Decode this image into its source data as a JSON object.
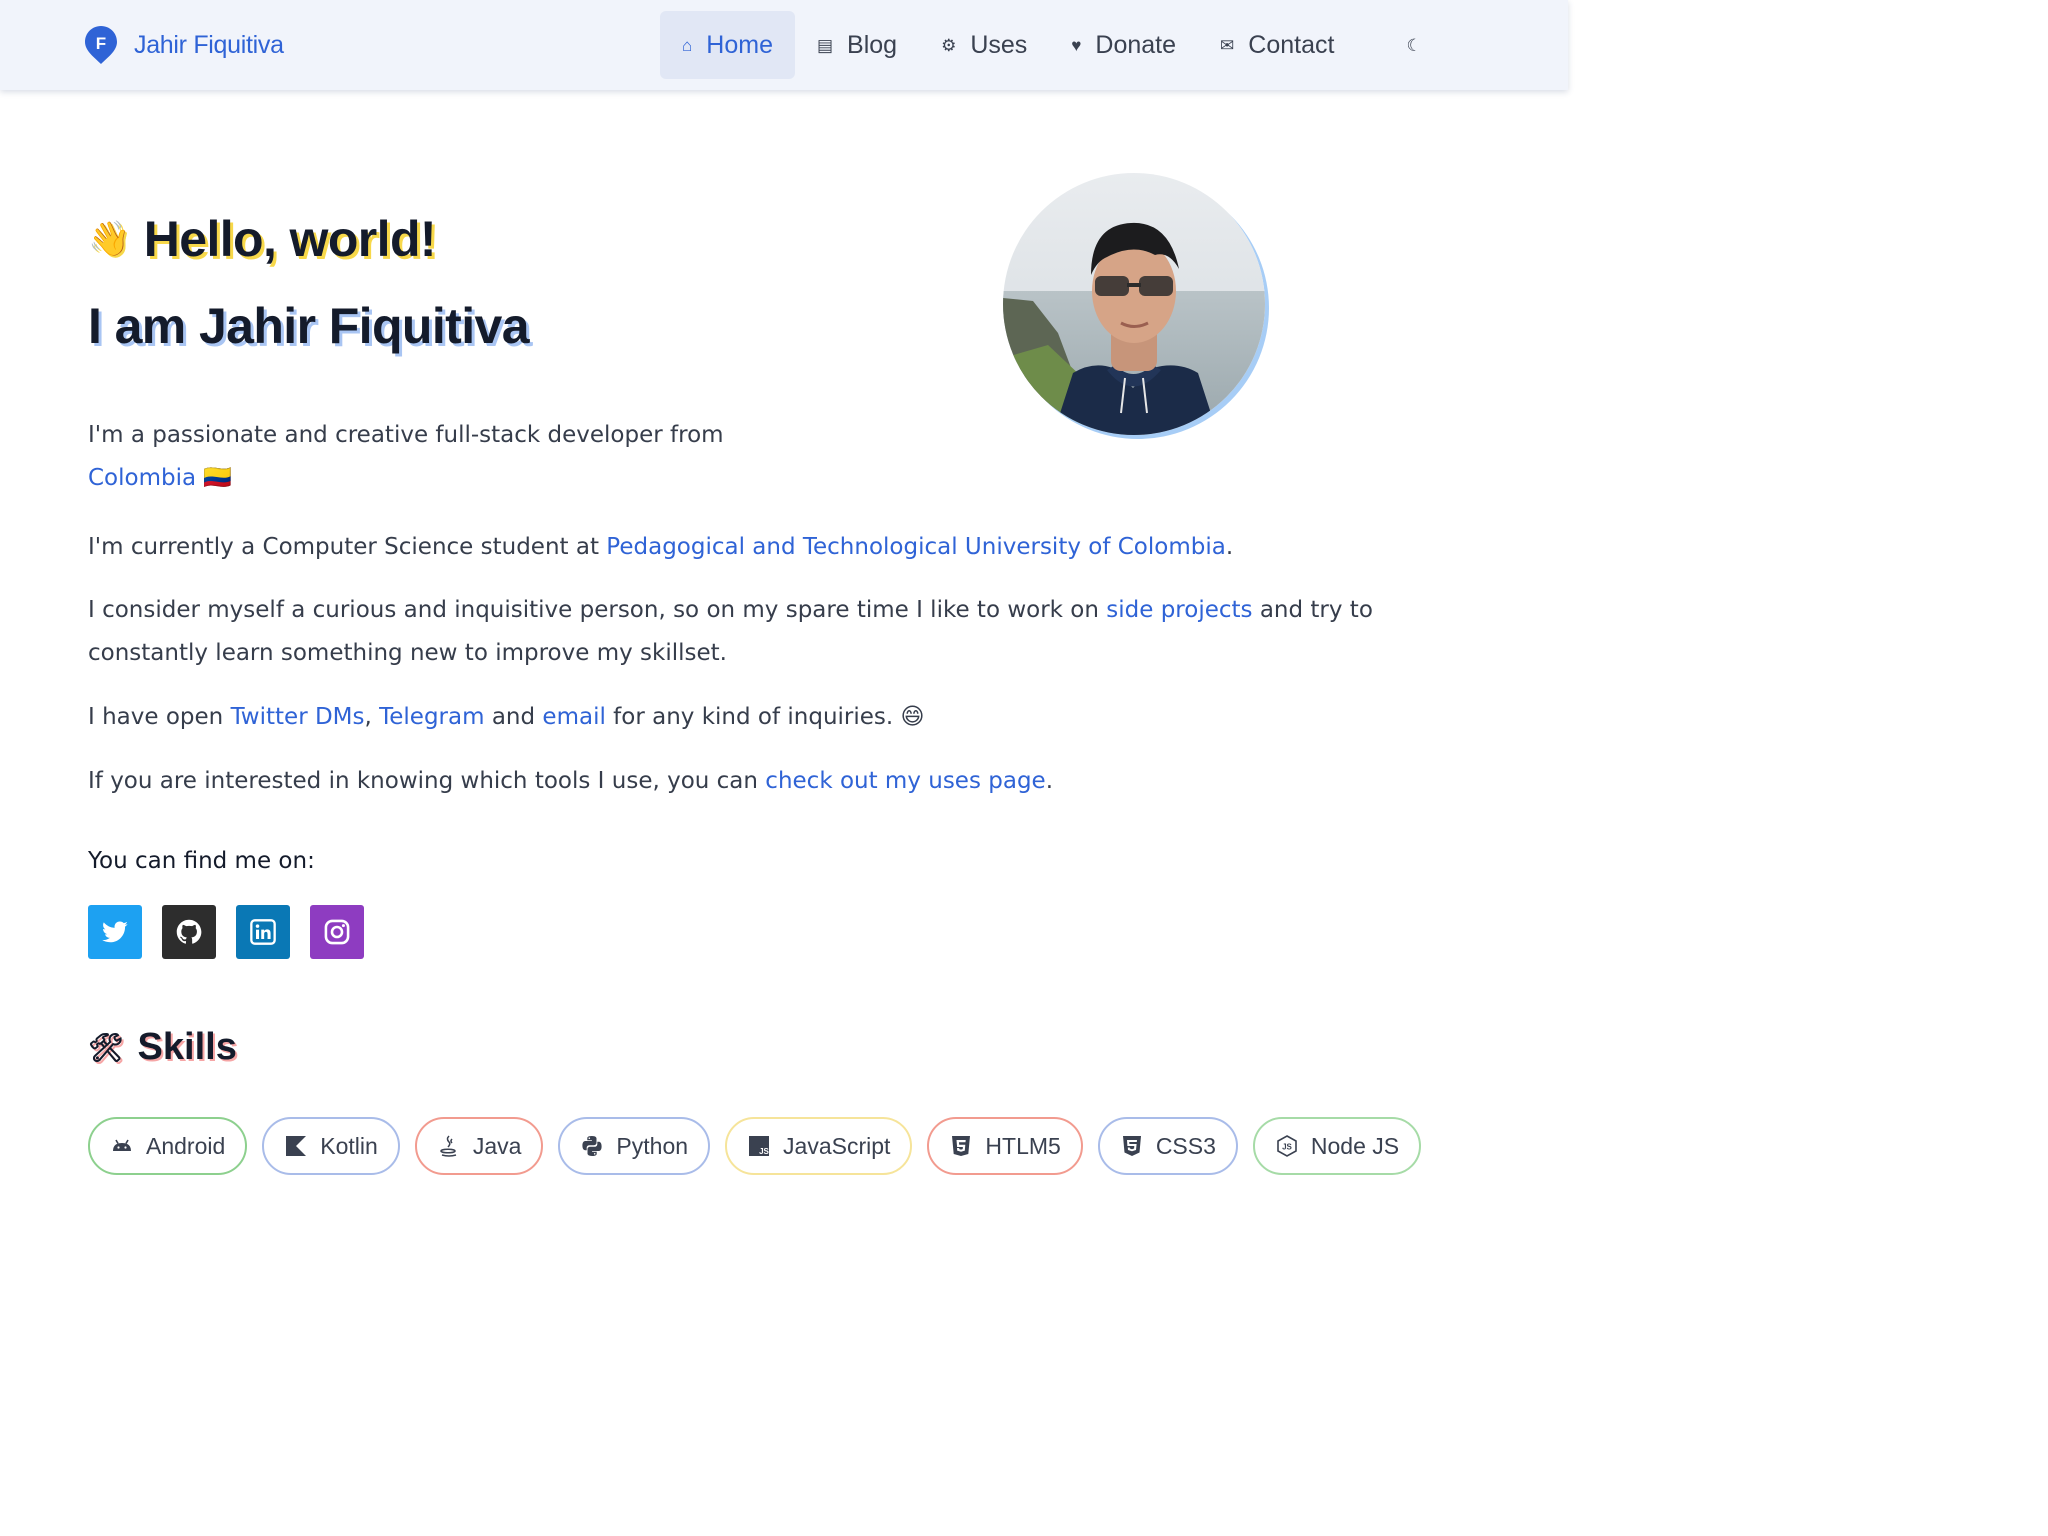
{
  "brand": {
    "name": "Jahir Fiquitiva",
    "logo_icon": "pin-logo-icon",
    "color": "#2f63d6"
  },
  "nav": [
    {
      "label": "Home",
      "icon": "home-icon",
      "glyph": "⌂",
      "active": true
    },
    {
      "label": "Blog",
      "icon": "document-icon",
      "glyph": "▤",
      "active": false
    },
    {
      "label": "Uses",
      "icon": "tools-icon",
      "glyph": "⚙",
      "active": false
    },
    {
      "label": "Donate",
      "icon": "heart-icon",
      "glyph": "♥",
      "active": false
    },
    {
      "label": "Contact",
      "icon": "mail-icon",
      "glyph": "✉",
      "active": false
    }
  ],
  "theme_toggle": {
    "icon": "theme-toggle-icon",
    "glyph": "☾"
  },
  "hero": {
    "wave_emoji": "👋",
    "title": "Hello, world!",
    "subtitle": "I am Jahir Fiquitiva",
    "avatar": "profile-photo"
  },
  "about": {
    "p1_text": "I'm a passionate and creative full-stack developer from",
    "p1_link": "Colombia 🇨🇴",
    "p2_text": "I'm currently a Computer Science student at ",
    "p2_link": "Pedagogical and Technological University of Colombia",
    "p2_end": ".",
    "p3_text_a": "I consider myself a curious and inquisitive person, so on my spare time I like to work on ",
    "p3_link": "side projects",
    "p3_text_b": " and try to constantly learn something new to improve my skillset.",
    "p4_text_a": "I have open ",
    "p4_link_twitter": "Twitter DMs",
    "p4_comma": ", ",
    "p4_link_telegram": "Telegram",
    "p4_and": " and ",
    "p4_link_email": "email",
    "p4_text_b": " for any kind of inquiries. ",
    "p4_emoji": "😄",
    "p5_text": "If you are interested in knowing which tools I use, you can ",
    "p5_link": "check out my uses page",
    "p5_end": "."
  },
  "find_me": {
    "title": "You can find me on:",
    "socials": [
      {
        "name": "twitter",
        "color": "#1da1f2"
      },
      {
        "name": "github",
        "color": "#2d2d2d"
      },
      {
        "name": "linkedin",
        "color": "#0a78b5"
      },
      {
        "name": "instagram",
        "color": "#8e3cc1"
      }
    ]
  },
  "skills": {
    "emoji": "🛠",
    "title": "Skills",
    "items": [
      {
        "label": "Android",
        "icon": "android-icon",
        "color": "#8dd08e"
      },
      {
        "label": "Kotlin",
        "icon": "kotlin-icon",
        "color": "#a9bce9"
      },
      {
        "label": "Java",
        "icon": "java-icon",
        "color": "#f29b8f"
      },
      {
        "label": "Python",
        "icon": "python-icon",
        "color": "#a9bce9"
      },
      {
        "label": "JavaScript",
        "icon": "javascript-icon",
        "color": "#f6e49a"
      },
      {
        "label": "HTLM5",
        "icon": "html5-icon",
        "color": "#f29b8f"
      },
      {
        "label": "CSS3",
        "icon": "css3-icon",
        "color": "#a9bce9"
      },
      {
        "label": "Node JS",
        "icon": "nodejs-icon",
        "color": "#a6dba7"
      }
    ]
  }
}
